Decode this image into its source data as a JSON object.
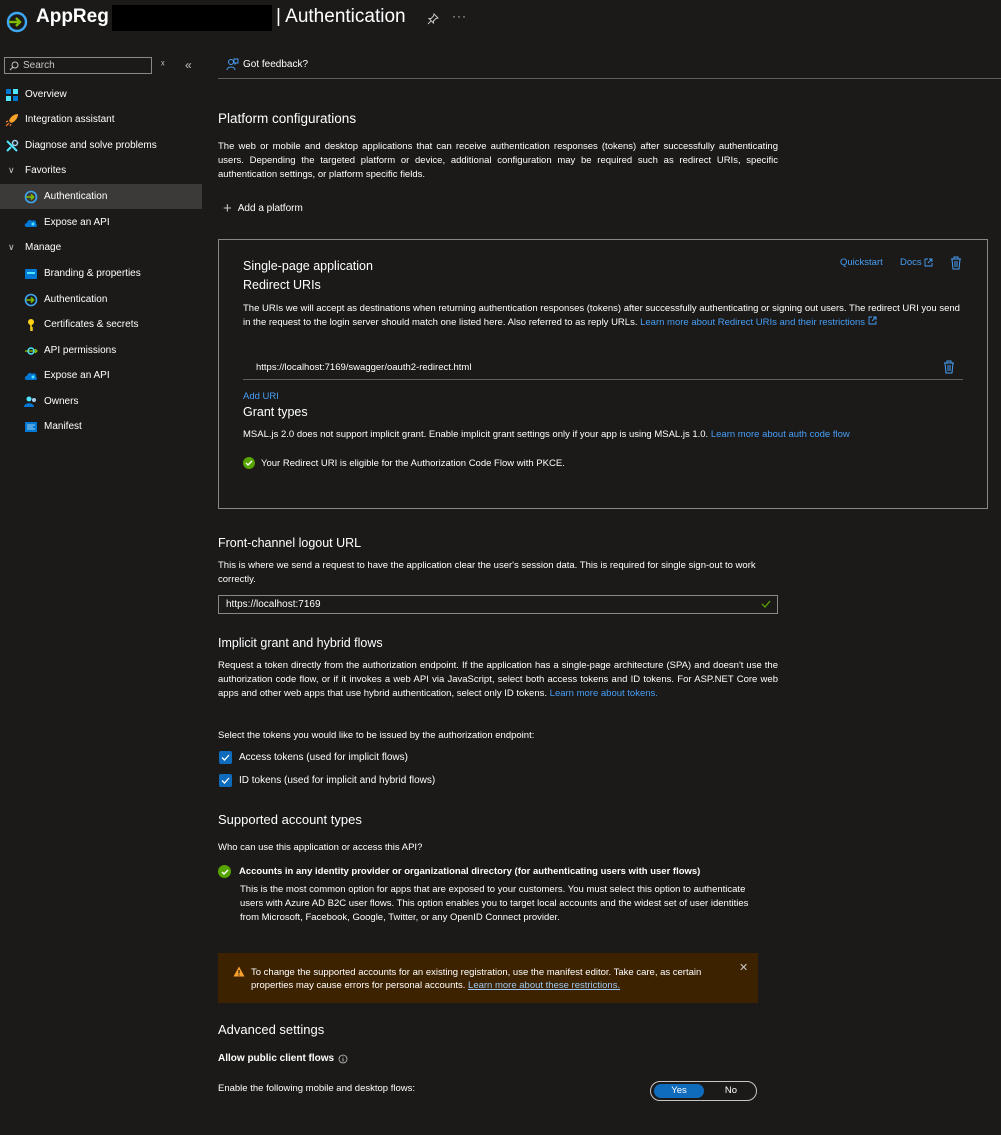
{
  "header": {
    "app_title": "AppReg",
    "page_title": "| Authentication",
    "more": "···"
  },
  "sidebar": {
    "search_placeholder": "Search",
    "items": [
      {
        "label": "Overview",
        "icon": "overview-grid-icon"
      },
      {
        "label": "Integration assistant",
        "icon": "rocket-icon"
      },
      {
        "label": "Diagnose and solve problems",
        "icon": "wrench-icon"
      },
      {
        "label": "Favorites",
        "icon": "chevron-down-icon"
      },
      {
        "label": "Authentication",
        "icon": "authentication-icon",
        "active": true
      },
      {
        "label": "Expose an API",
        "icon": "cloud-icon"
      },
      {
        "label": "Manage",
        "icon": "chevron-down-icon"
      },
      {
        "label": "Branding & properties",
        "icon": "branding-icon"
      },
      {
        "label": "Authentication",
        "icon": "authentication-icon"
      },
      {
        "label": "Certificates & secrets",
        "icon": "key-icon"
      },
      {
        "label": "API permissions",
        "icon": "api-permissions-icon"
      },
      {
        "label": "Expose an API",
        "icon": "cloud-icon"
      },
      {
        "label": "Owners",
        "icon": "owners-icon"
      },
      {
        "label": "Manifest",
        "icon": "manifest-icon"
      }
    ]
  },
  "toolbar": {
    "feedback": "Got feedback?"
  },
  "platform": {
    "title": "Platform configurations",
    "description": "The web or mobile and desktop applications that can receive authentication responses (tokens) after successfully authenticating users. Depending the targeted platform or device, additional configuration may be required such as redirect URIs, specific authentication settings, or platform specific fields.",
    "add_label": "Add a platform"
  },
  "spa": {
    "title": "Single-page application",
    "quickstart": "Quickstart",
    "docs": "Docs",
    "redirect_title": "Redirect URIs",
    "redirect_desc": "The URIs we will accept as destinations when returning authentication responses (tokens) after successfully authenticating or signing out users. The redirect URI you send in the request to the login server should match one listed here. Also referred to as reply URLs.",
    "redirect_link": "Learn more about Redirect URIs and their restrictions",
    "uri": "https://localhost:7169/swagger/oauth2-redirect.html",
    "add_uri": "Add URI",
    "grant_title": "Grant types",
    "grant_desc": "MSAL.js 2.0 does not support implicit grant. Enable implicit grant settings only if your app is using MSAL.js 1.0.",
    "grant_link": "Learn more about auth code flow",
    "pkce_status": "Your Redirect URI is eligible for the Authorization Code Flow with PKCE."
  },
  "logout": {
    "title": "Front-channel logout URL",
    "description": "This is where we send a request to have the application clear the user's session data. This is required for single sign-out to work correctly.",
    "value": "https://localhost:7169"
  },
  "implicit": {
    "title": "Implicit grant and hybrid flows",
    "description": "Request a token directly from the authorization endpoint. If the application has a single-page architecture (SPA) and doesn't use the authorization code flow, or if it invokes a web API via JavaScript, select both access tokens and ID tokens. For ASP.NET Core web apps and other web apps that use hybrid authentication, select only ID tokens.",
    "link": "Learn more about tokens.",
    "select_prompt": "Select the tokens you would like to be issued by the authorization endpoint:",
    "access_tokens": "Access tokens (used for implicit flows)",
    "id_tokens": "ID tokens (used for implicit and hybrid flows)"
  },
  "accounts": {
    "title": "Supported account types",
    "question": "Who can use this application or access this API?",
    "selected_title": "Accounts in any identity provider or organizational directory (for authenticating users with user flows)",
    "selected_desc": "This is the most common option for apps that are exposed to your customers. You must select this option to authenticate users with Azure AD B2C user flows. This option enables you to target local accounts and the widest set of user identities from Microsoft, Facebook, Google, Twitter, or any OpenID Connect provider.",
    "warning": "To change the supported accounts for an existing registration, use the manifest editor. Take care, as certain properties may cause errors for personal accounts.",
    "warning_link": "Learn more about these restrictions."
  },
  "advanced": {
    "title": "Advanced settings",
    "public_flows": "Allow public client flows",
    "enable_label": "Enable the following mobile and desktop flows:",
    "yes": "Yes",
    "no": "No"
  },
  "colors": {
    "background": "#1b1a19",
    "link": "#479ef5",
    "accent": "#0f6cbd",
    "success": "#57a300",
    "warning_bg": "#3d2200",
    "warning_icon": "#f7a12b"
  }
}
